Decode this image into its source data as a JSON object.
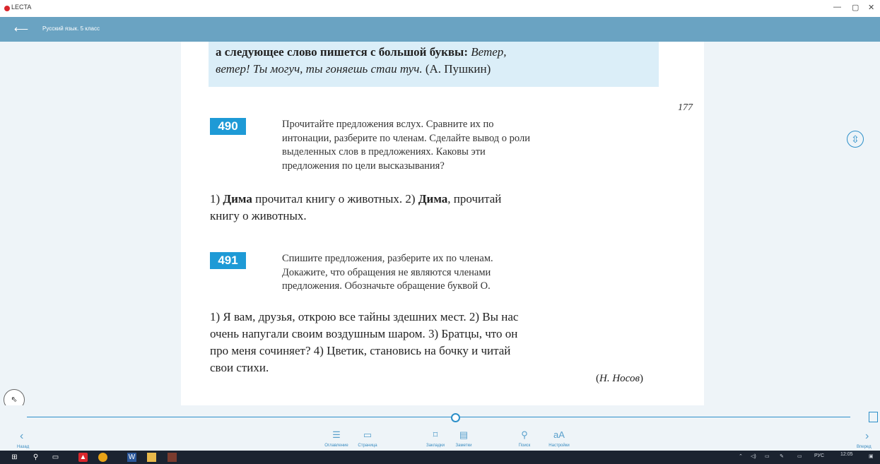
{
  "app": {
    "name": "LECTA"
  },
  "window": {
    "minimize": "—",
    "maximize": "▢",
    "close": "✕"
  },
  "toolbar": {
    "back_icon": "arrow-left-icon",
    "book_title": "Русский язык. 5 класс"
  },
  "page": {
    "number": "177",
    "rule": {
      "bold": "а следующее слово пишется с большой буквы:",
      "italic1": "Ветер,",
      "italic2": "ветер! Ты могуч, ты гоняешь стаи туч.",
      "attribution": "(А. Пушкин)"
    },
    "exercises": [
      {
        "number": "490",
        "task_lines": [
          "Прочитайте предложения вслух. Сравните их по",
          "интонации, разберите по членам. Сделайте вывод о роли",
          "выделенных слов в предложениях. Каковы эти",
          "предложения по цели высказывания?"
        ],
        "example": {
          "p1": "1)",
          "b1": "Дима",
          "p2": "прочитал книгу о животных. 2)",
          "b2": "Дима",
          "p3": ", прочитай",
          "line2": "книгу о животных."
        }
      },
      {
        "number": "491",
        "task_lines": [
          "Спишите предложения, разберите их по членам.",
          "Докажите, что обращения не являются членами",
          "предложения. Обозначьте обращение буквой О."
        ],
        "example_lines": [
          "1) Я вам, друзья, открою все тайны здешних мест. 2) Вы нас",
          "очень напугали своим воздушным шаром. 3) Братцы, что он",
          "про меня сочиняет? 4) Цветик, становись на бочку и читай",
          "свои стихи."
        ],
        "author": "Н. Носов"
      }
    ]
  },
  "slider": {
    "position": 0.52
  },
  "bottom_nav": {
    "prev_label": "Назад",
    "next_label": "Вперед",
    "items": [
      {
        "label": "Оглавление",
        "icon": "list-icon"
      },
      {
        "label": "Страница",
        "icon": "page-icon"
      },
      {
        "label": "Закладки",
        "icon": "bookmark-icon"
      },
      {
        "label": "Заметки",
        "icon": "notes-icon"
      },
      {
        "label": "Поиск",
        "icon": "search-icon"
      },
      {
        "label": "Настройки",
        "icon": "font-size-icon"
      }
    ],
    "settings_glyph": "aA"
  },
  "taskbar": {
    "lang": "РУС",
    "time": "12:05"
  }
}
